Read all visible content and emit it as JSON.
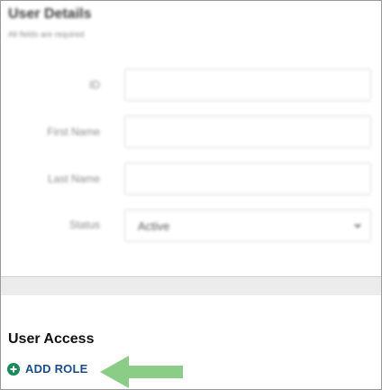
{
  "user_details": {
    "title": "User Details",
    "subtitle": "All fields are required",
    "fields": [
      {
        "label": "ID",
        "value": ""
      },
      {
        "label": "First Name",
        "value": ""
      },
      {
        "label": "Last Name",
        "value": ""
      }
    ],
    "status": {
      "label": "Status",
      "value": "Active"
    }
  },
  "user_access": {
    "title": "User Access",
    "add_role_label": "ADD ROLE"
  },
  "colors": {
    "add_role_icon": "#1a8a5a",
    "add_role_text": "#1b4d8a",
    "highlight_arrow": "#7ec87a"
  },
  "icons": {
    "add_role": "plus-circle-icon",
    "status_dropdown": "chevron-down-icon",
    "callout": "arrow-left-icon"
  }
}
